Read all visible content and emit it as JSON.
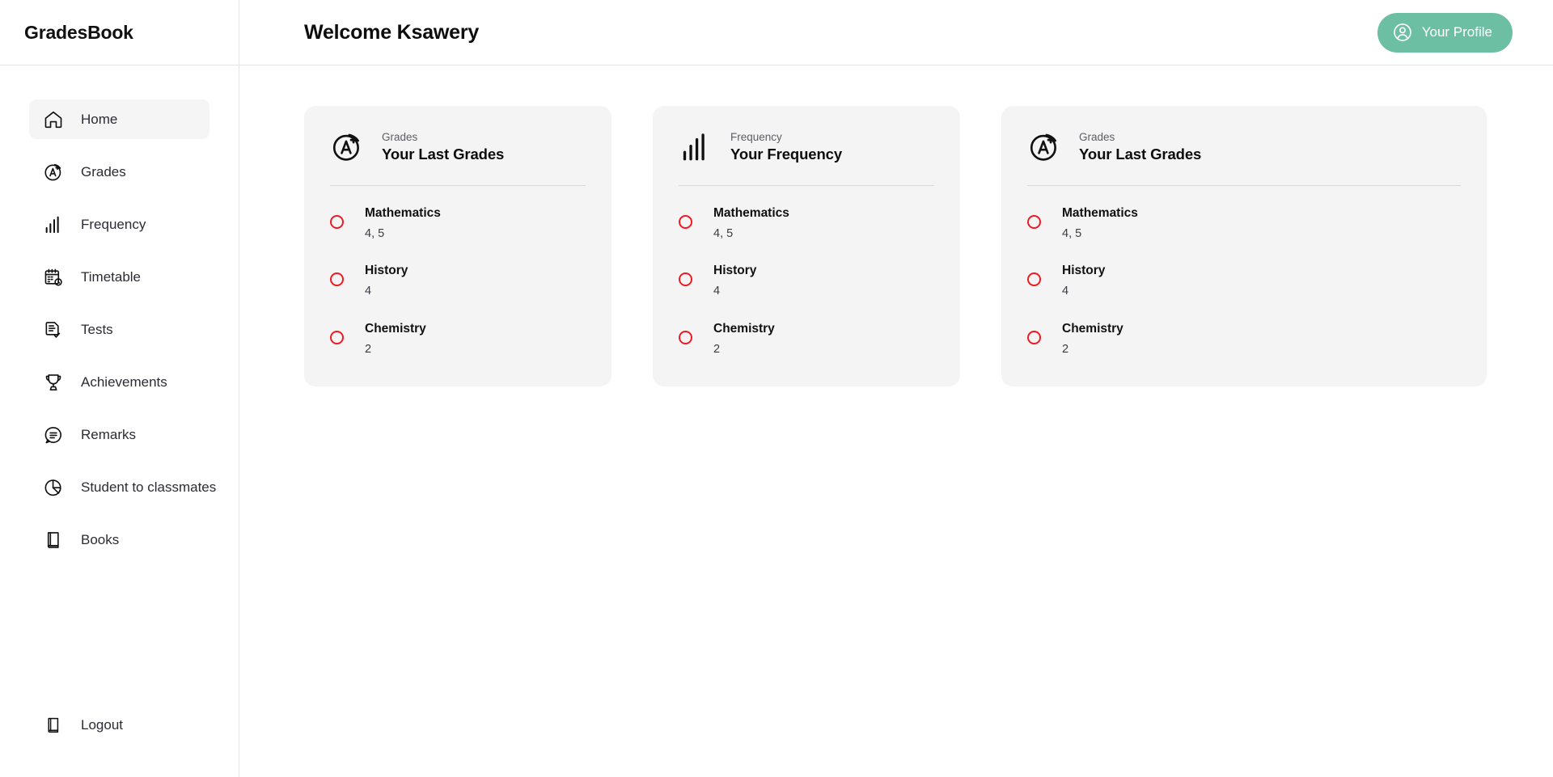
{
  "sidebar": {
    "brand": "GradesBook",
    "items": [
      {
        "label": "Home",
        "icon": "home-icon",
        "active": true
      },
      {
        "label": "Grades",
        "icon": "grade-a-plus-icon",
        "active": false
      },
      {
        "label": "Frequency",
        "icon": "bar-chart-icon",
        "active": false
      },
      {
        "label": "Timetable",
        "icon": "calendar-clock-icon",
        "active": false
      },
      {
        "label": "Tests",
        "icon": "document-check-icon",
        "active": false
      },
      {
        "label": "Achievements",
        "icon": "trophy-icon",
        "active": false
      },
      {
        "label": "Remarks",
        "icon": "chat-bubble-icon",
        "active": false
      },
      {
        "label": "Student to classmates",
        "icon": "pie-chart-icon",
        "active": false
      },
      {
        "label": "Books",
        "icon": "book-icon",
        "active": false
      }
    ],
    "logout": {
      "label": "Logout",
      "icon": "book-icon"
    }
  },
  "header": {
    "title": "Welcome Ksawery",
    "profile_button": {
      "label": "Your Profile",
      "icon": "user-circle-icon",
      "color": "#6cbfa2"
    }
  },
  "colors": {
    "accent": "#6cbfa2",
    "bullet": "#ee1b24",
    "card_bg": "#f4f4f4",
    "active_nav_bg": "#f5f5f5"
  },
  "cards": [
    {
      "eyebrow": "Grades",
      "title": "Your Last Grades",
      "icon": "grade-a-plus-icon",
      "width": "narrow",
      "items": [
        {
          "subject": "Mathematics",
          "grades": "4, 5"
        },
        {
          "subject": "History",
          "grades": "4"
        },
        {
          "subject": "Chemistry",
          "grades": "2"
        }
      ]
    },
    {
      "eyebrow": "Frequency",
      "title": "Your Frequency",
      "icon": "bar-chart-icon",
      "width": "narrow",
      "items": [
        {
          "subject": "Mathematics",
          "grades": "4, 5"
        },
        {
          "subject": "History",
          "grades": "4"
        },
        {
          "subject": "Chemistry",
          "grades": "2"
        }
      ]
    },
    {
      "eyebrow": "Grades",
      "title": "Your Last Grades",
      "icon": "grade-a-plus-icon",
      "width": "wide",
      "items": [
        {
          "subject": "Mathematics",
          "grades": "4, 5"
        },
        {
          "subject": "History",
          "grades": "4"
        },
        {
          "subject": "Chemistry",
          "grades": "2"
        }
      ]
    }
  ]
}
